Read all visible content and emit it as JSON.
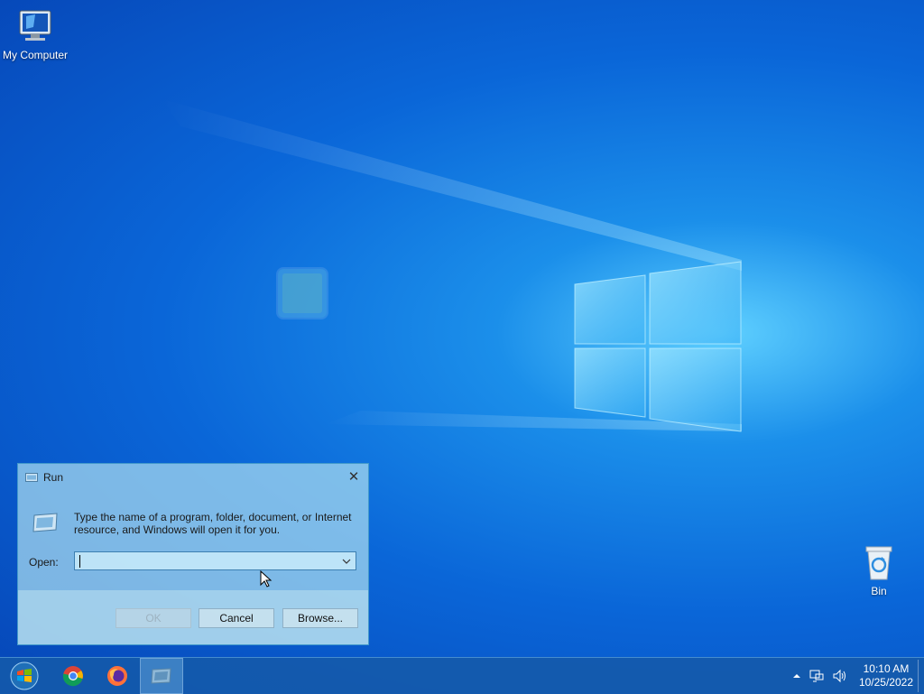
{
  "desktop": {
    "icons": [
      {
        "label": "My Computer"
      },
      {
        "label": "Bin"
      }
    ]
  },
  "run_dialog": {
    "title": "Run",
    "description": "Type the name of a program, folder, document, or Internet resource, and Windows will open it for you.",
    "open_label": "Open:",
    "open_value": "",
    "buttons": {
      "ok": "OK",
      "cancel": "Cancel",
      "browse": "Browse..."
    }
  },
  "taskbar": {
    "items": [
      "start-orb",
      "chrome",
      "firefox",
      "run-window"
    ],
    "clock_time": "10:10 AM",
    "clock_date": "10/25/2022"
  },
  "colors": {
    "desktop_blue": "#0a66d8",
    "taskbar": "#145aaa"
  }
}
